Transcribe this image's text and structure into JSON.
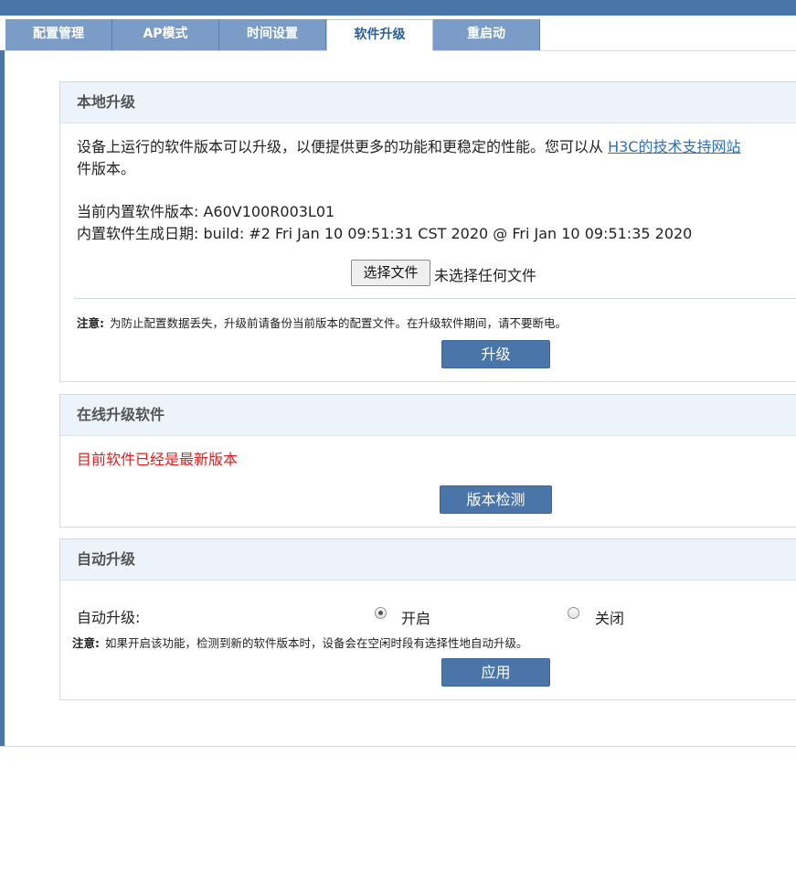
{
  "tabs": [
    {
      "label": "配置管理",
      "active": false
    },
    {
      "label": "AP模式",
      "active": false
    },
    {
      "label": "时间设置",
      "active": false
    },
    {
      "label": "软件升级",
      "active": true
    },
    {
      "label": "重启动",
      "active": false
    }
  ],
  "local_upgrade": {
    "title": "本地升级",
    "desc_line1": "设备上运行的软件版本可以升级，以便提供更多的功能和更稳定的性能。您可以从 ",
    "desc_link": "H3C的技术支持网站",
    "desc_line2": "件版本。",
    "version_label": "当前内置软件版本: ",
    "version_value": "A60V100R003L01",
    "date_label": "内置软件生成日期:  ",
    "date_value": "build: #2 Fri Jan 10 09:51:31 CST 2020 @ Fri Jan 10 09:51:35 2020",
    "choose_file_label": "选择文件",
    "no_file_text": "未选择任何文件",
    "note_label": "注意:",
    "note_text": "为防止配置数据丢失，升级前请备份当前版本的配置文件。在升级软件期间，请不要断电。",
    "upgrade_button": "升级"
  },
  "online_upgrade": {
    "title": "在线升级软件",
    "status_text": "目前软件已经是最新版本",
    "status_color": "#e02020",
    "check_button": "版本检测"
  },
  "auto_upgrade": {
    "title": "自动升级",
    "label": "自动升级:",
    "option_on": "开启",
    "option_off": "关闭",
    "selected": "开启",
    "note_label": "注意:",
    "note_text": "如果开启该功能，检测到新的软件版本时，设备会在空闲时段有选择性地自动升级。",
    "apply_button": "应用"
  },
  "colors": {
    "accent": "#4a75a8",
    "tab_inactive": "#7b9cc6",
    "panel_header_bg": "#edf3fb"
  }
}
